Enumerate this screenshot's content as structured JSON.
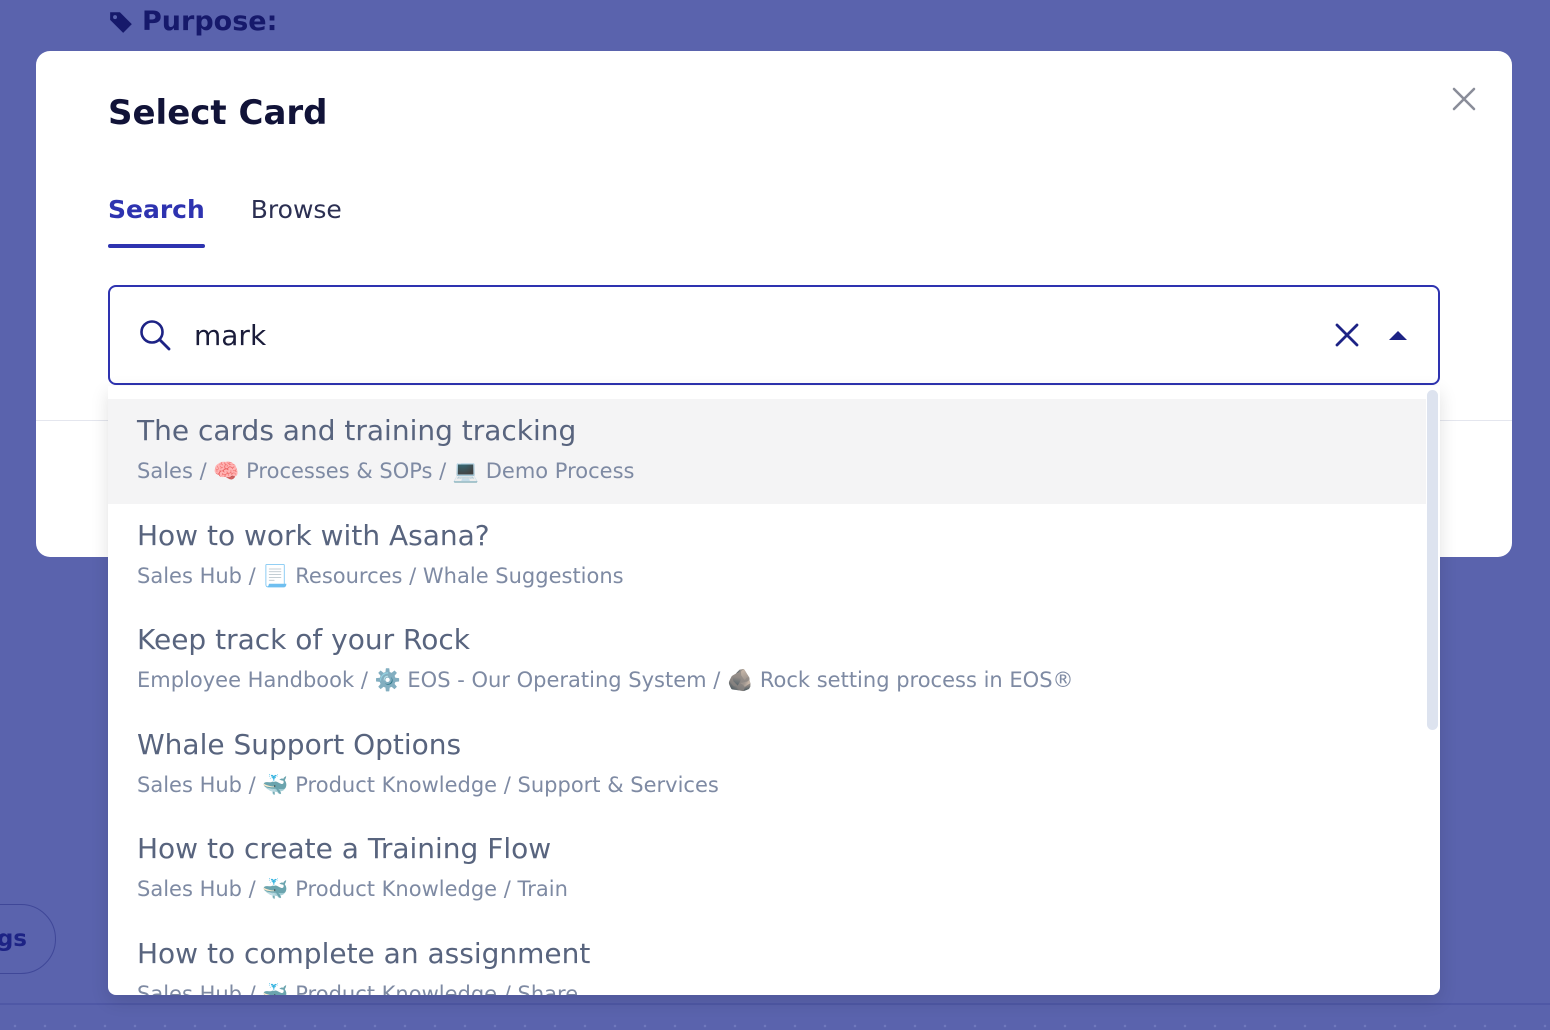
{
  "background": {
    "purpose_label": "Purpose:",
    "pill_label": "gs"
  },
  "modal": {
    "title": "Select Card",
    "tabs": [
      {
        "label": "Search",
        "active": true
      },
      {
        "label": "Browse",
        "active": false
      }
    ]
  },
  "search": {
    "value": "mark"
  },
  "results": [
    {
      "title": "The cards and training tracking",
      "path": "Sales / 🧠 Processes & SOPs / 💻 Demo Process"
    },
    {
      "title": "How to work with Asana?",
      "path": "Sales Hub / 📃 Resources / Whale Suggestions"
    },
    {
      "title": "Keep track of your Rock",
      "path": "Employee Handbook / ⚙️ EOS - Our Operating System / 🪨 Rock setting process in EOS®"
    },
    {
      "title": "Whale Support Options",
      "path": "Sales Hub / 🐳 Product Knowledge / Support & Services"
    },
    {
      "title": "How to create a Training Flow",
      "path": "Sales Hub / 🐳 Product Knowledge / Train"
    },
    {
      "title": "How to complete an assignment",
      "path": "Sales Hub / 🐳 Product Knowledge / Share"
    }
  ],
  "colors": {
    "accent": "#2e33b0",
    "page_background": "#5a63ad",
    "highlight_row": "#f4f4f5"
  }
}
